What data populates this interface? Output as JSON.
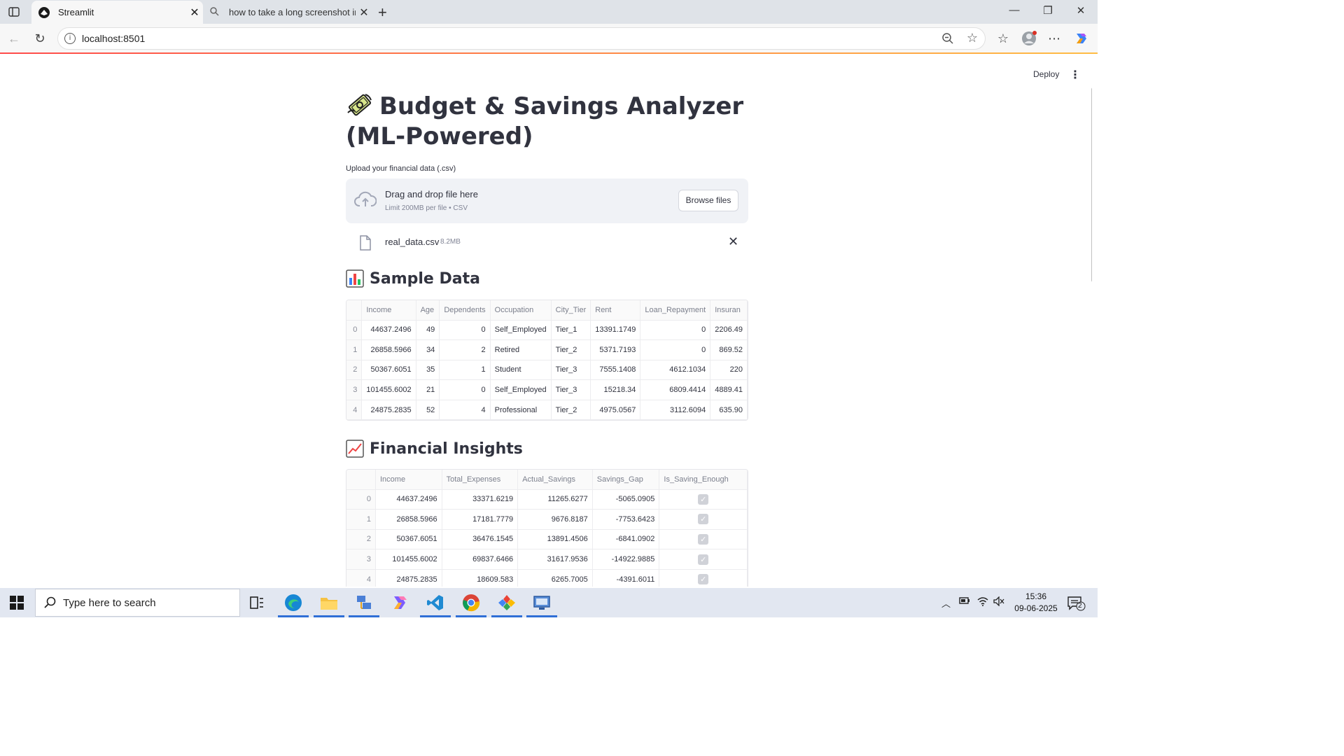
{
  "browser": {
    "active_tab_title": "Streamlit",
    "inactive_tab_title": "how to take a long screenshot in",
    "url": "localhost:8501"
  },
  "header": {
    "deploy_label": "Deploy"
  },
  "page": {
    "title": "Budget & Savings Analyzer (ML-Powered)",
    "uploader": {
      "label": "Upload your financial data (.csv)",
      "drop_title": "Drag and drop file here",
      "drop_subtitle": "Limit 200MB per file • CSV",
      "browse_label": "Browse files"
    },
    "uploaded_file": {
      "name": "real_data.csv",
      "size": "8.2MB"
    },
    "sample_data": {
      "heading": "Sample Data",
      "columns": [
        "",
        "Income",
        "Age",
        "Dependents",
        "Occupation",
        "City_Tier",
        "Rent",
        "Loan_Repayment",
        "Insuran"
      ],
      "rows": [
        [
          "0",
          "44637.2496",
          "49",
          "0",
          "Self_Employed",
          "Tier_1",
          "13391.1749",
          "0",
          "2206.49"
        ],
        [
          "1",
          "26858.5966",
          "34",
          "2",
          "Retired",
          "Tier_2",
          "5371.7193",
          "0",
          "869.52"
        ],
        [
          "2",
          "50367.6051",
          "35",
          "1",
          "Student",
          "Tier_3",
          "7555.1408",
          "4612.1034",
          "220"
        ],
        [
          "3",
          "101455.6002",
          "21",
          "0",
          "Self_Employed",
          "Tier_3",
          "15218.34",
          "6809.4414",
          "4889.41"
        ],
        [
          "4",
          "24875.2835",
          "52",
          "4",
          "Professional",
          "Tier_2",
          "4975.0567",
          "3112.6094",
          "635.90"
        ]
      ]
    },
    "financial_insights": {
      "heading": "Financial Insights",
      "columns": [
        "",
        "Income",
        "Total_Expenses",
        "Actual_Savings",
        "Savings_Gap",
        "Is_Saving_Enough"
      ],
      "rows": [
        [
          "0",
          "44637.2496",
          "33371.6219",
          "11265.6277",
          "-5065.0905"
        ],
        [
          "1",
          "26858.5966",
          "17181.7779",
          "9676.8187",
          "-7753.6423"
        ],
        [
          "2",
          "50367.6051",
          "36476.1545",
          "13891.4506",
          "-6841.0902"
        ],
        [
          "3",
          "101455.6002",
          "69837.6466",
          "31617.9536",
          "-14922.9885"
        ],
        [
          "4",
          "24875.2835",
          "18609.583",
          "6265.7005",
          "-4391.6011"
        ]
      ]
    }
  },
  "taskbar": {
    "search_placeholder": "Type here to search",
    "time": "15:36",
    "date": "09-06-2025",
    "notification_count": "2"
  }
}
